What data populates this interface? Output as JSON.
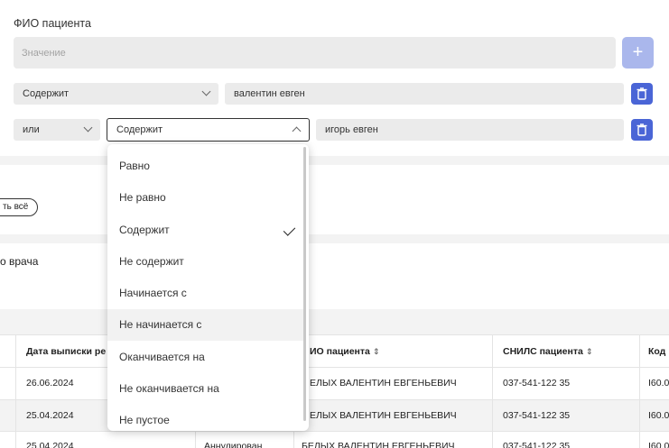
{
  "filter": {
    "title": "ФИО пациента",
    "value_placeholder": "Значение",
    "add_label": "+",
    "row1": {
      "operator": "Содержит",
      "value": "валентин евген"
    },
    "row2": {
      "connector": "или",
      "operator": "Содержит",
      "value": "игорь евген"
    }
  },
  "toolbar": {
    "select_all_partial": "ть всё"
  },
  "doctor_label": "о врача",
  "table": {
    "headers": [
      "Дата выписки ре",
      "ИО пациента",
      "СНИЛС пациента",
      "Код"
    ],
    "rows": [
      {
        "date": "26.06.2024",
        "name": "ЕЛЫХ ВАЛЕНТИН ЕВГЕНЬЕВИЧ",
        "snils": "037-541-122 35",
        "code": "I60.0"
      },
      {
        "date": "25.04.2024",
        "name": "ЕЛЫХ ВАЛЕНТИН ЕВГЕНЬЕВИЧ",
        "snils": "037-541-122 35",
        "code": "I60.0"
      },
      {
        "date": "25.04.2024",
        "status": "Аннулирован",
        "name": "БЕЛЫХ ВАЛЕНТИН ЕВГЕНЬЕВИЧ",
        "snils": "037-541-122 35",
        "code": "I60.0"
      }
    ]
  },
  "dropdown": {
    "options": [
      "Равно",
      "Не равно",
      "Содержит",
      "Не содержит",
      "Начинается с",
      "Не начинается с",
      "Оканчивается на",
      "Не оканчивается на",
      "Не пустое"
    ],
    "selected_index": 2,
    "hover_index": 5
  },
  "colors": {
    "accent": "#4a65d6",
    "accent_disabled": "#aab7ec",
    "field_bg": "#ebebeb"
  }
}
